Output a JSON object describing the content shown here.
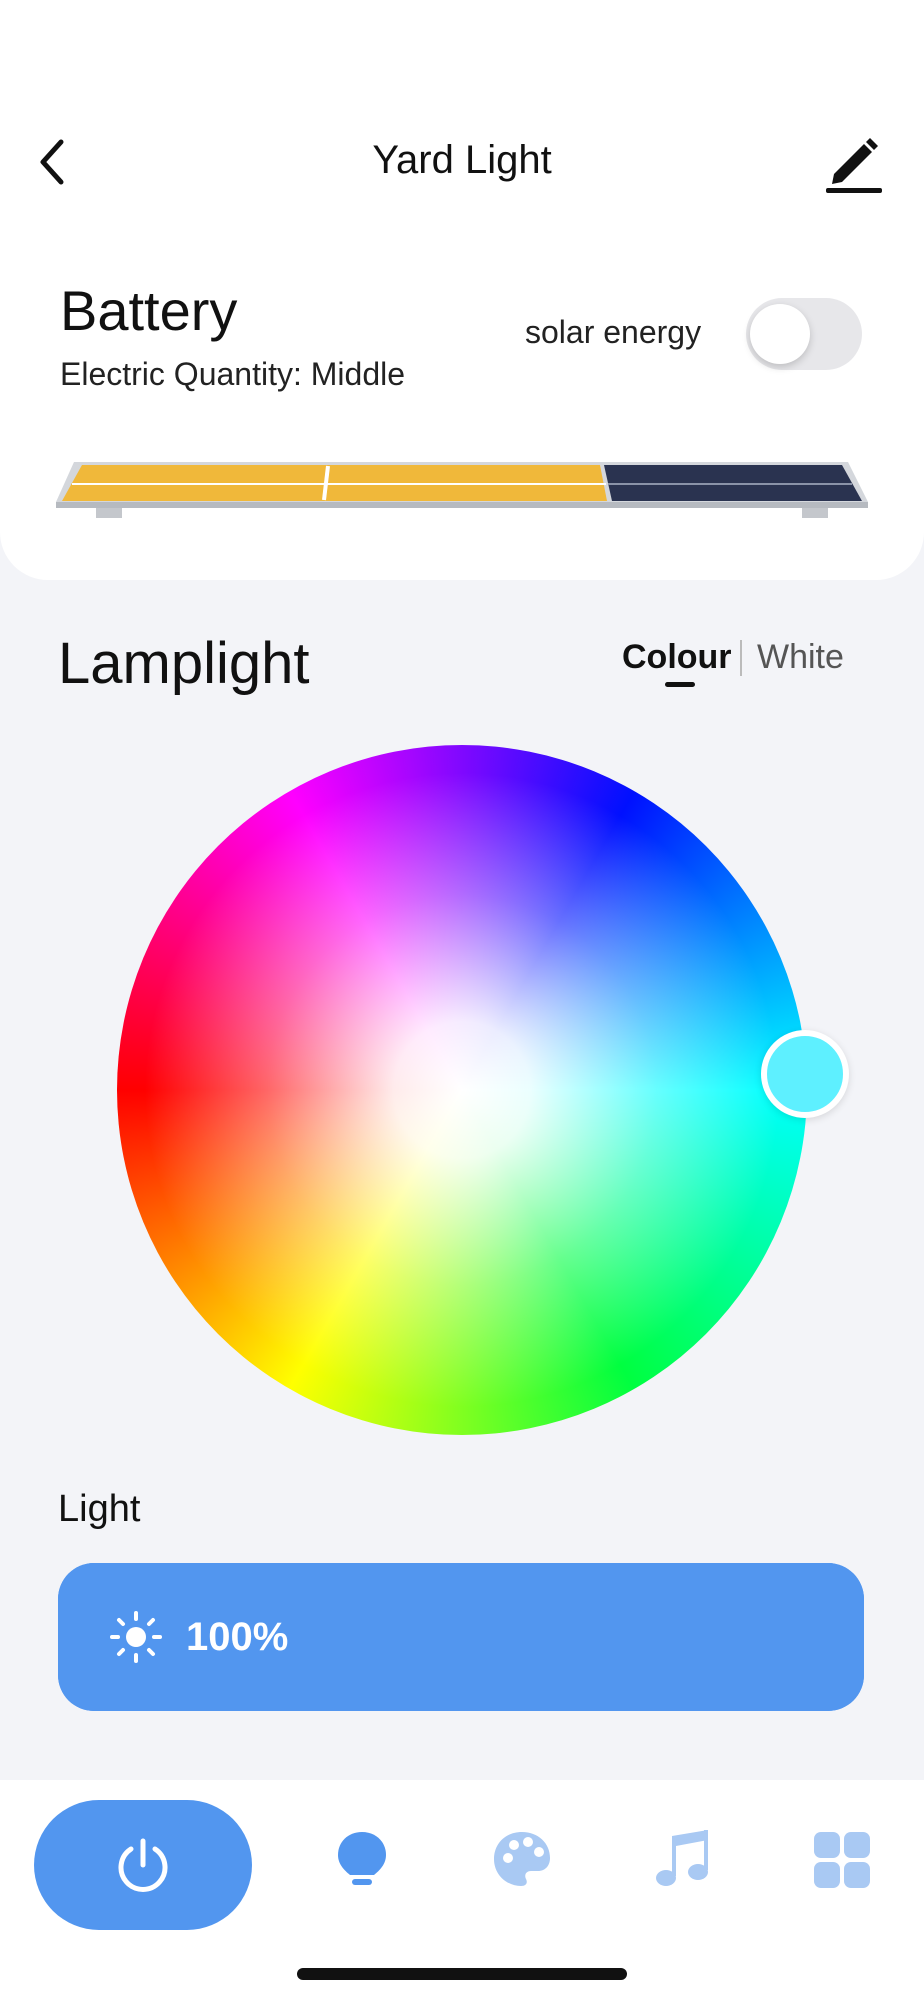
{
  "header": {
    "title": "Yard Light",
    "back_icon": "chevron-left-icon",
    "edit_icon": "pencil-icon"
  },
  "battery": {
    "title": "Battery",
    "subtitle": "Electric Quantity: Middle",
    "solar_label": "solar energy",
    "solar_enabled": false,
    "panel_colors": {
      "charged": "#f0b83a",
      "empty": "#2a3350",
      "frame": "#c9cdd2"
    }
  },
  "lamplight": {
    "title": "Lamplight",
    "modes": [
      "Colour",
      "White"
    ],
    "active_mode": "Colour",
    "selected_color": "#5ef0ff"
  },
  "light": {
    "label": "Light",
    "brightness_text": "100%",
    "brightness_fraction": 1.0,
    "icon": "sun-icon"
  },
  "bottom_nav": {
    "accent": "#5296ef",
    "inactive": "#a9c9f3",
    "items": [
      "power-icon",
      "bulb-icon",
      "palette-icon",
      "music-note-icon",
      "grid-icon"
    ]
  }
}
